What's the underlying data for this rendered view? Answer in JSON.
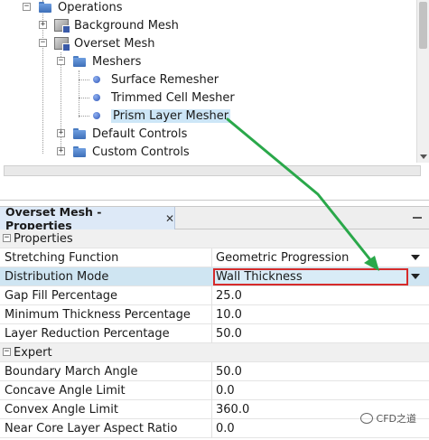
{
  "tree": {
    "nodes": [
      {
        "label": "Operations",
        "icon": "folder-icon"
      },
      {
        "label": "Background Mesh",
        "icon": "mesh-operation-icon"
      },
      {
        "label": "Overset Mesh",
        "icon": "mesh-operation-icon"
      },
      {
        "label": "Meshers",
        "icon": "folder-icon"
      },
      {
        "label": "Surface Remesher",
        "icon": "mesher-dot-icon"
      },
      {
        "label": "Trimmed Cell Mesher",
        "icon": "mesher-dot-icon"
      },
      {
        "label": "Prism Layer Mesher",
        "icon": "mesher-dot-icon",
        "selected": true
      },
      {
        "label": "Default Controls",
        "icon": "folder-icon"
      },
      {
        "label": "Custom Controls",
        "icon": "folder-icon"
      }
    ]
  },
  "properties": {
    "title": "Overset Mesh - Properties",
    "close_glyph": "✕",
    "categories": [
      {
        "name": "Properties",
        "rows": [
          {
            "name": "Stretching Function",
            "value": "Geometric Progression"
          },
          {
            "name": "Distribution Mode",
            "value": "Wall Thickness"
          },
          {
            "name": "Gap Fill Percentage",
            "value": "25.0"
          },
          {
            "name": "Minimum Thickness Percentage",
            "value": "10.0"
          },
          {
            "name": "Layer Reduction Percentage",
            "value": "50.0"
          }
        ]
      },
      {
        "name": "Expert",
        "rows": [
          {
            "name": "Boundary March Angle",
            "value": "50.0"
          },
          {
            "name": "Concave Angle Limit",
            "value": "0.0"
          },
          {
            "name": "Convex Angle Limit",
            "value": "360.0"
          },
          {
            "name": "Near Core Layer Aspect Ratio",
            "value": "0.0"
          }
        ]
      }
    ]
  },
  "watermark": "CFD之道",
  "colors": {
    "selection": "#cde6f7",
    "highlight_box": "#d62b2b",
    "arrow": "#2aa84a"
  }
}
